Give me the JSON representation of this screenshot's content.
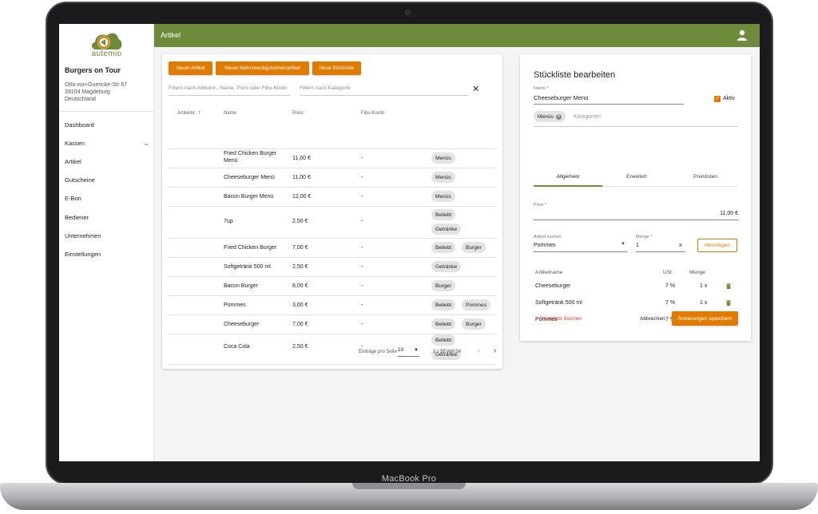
{
  "device": {
    "label": "MacBook Pro"
  },
  "sidebar": {
    "brand": "autemio",
    "company": "Burgers on Tour",
    "address": [
      "Otto-von-Guericke-Str 67",
      "39104 Magdeburg",
      "Deutschland"
    ],
    "items": [
      {
        "label": "Dashboard"
      },
      {
        "label": "Kassen",
        "expandable": true
      },
      {
        "label": "Artikel"
      },
      {
        "label": "Gutscheine"
      },
      {
        "label": "E-Bon"
      },
      {
        "label": "Bediener"
      },
      {
        "label": "Unternehmen"
      },
      {
        "label": "Einstellungen"
      }
    ]
  },
  "topbar": {
    "title": "Artikel",
    "user_icon": "user-icon"
  },
  "articles": {
    "buttons": {
      "new_article": "Neuer Artikel",
      "new_voucher_article": "Neuer Mehrzweckgutscheinartikel",
      "new_bom": "Neue Stückliste"
    },
    "filters": {
      "search_placeholder": "Filtern nach Artikelnr., Name, Preis oder Fibu-Konto",
      "category_placeholder": "Filtern nach Kategorie"
    },
    "columns": {
      "number": "Artikelnr.",
      "name": "Name",
      "price": "Preis",
      "account": "Fibu-Konto"
    },
    "rows": [
      {
        "number": "",
        "name": "Fried Chicken Burger Menü",
        "price": "11,00 €",
        "account": "-",
        "tags": [
          "Menüs"
        ]
      },
      {
        "number": "",
        "name": "Cheeseburger Menü",
        "price": "11,00 €",
        "account": "-",
        "tags": [
          "Menüs"
        ]
      },
      {
        "number": "",
        "name": "Bacon Burger Menü",
        "price": "12,00 €",
        "account": "-",
        "tags": [
          "Menüs"
        ]
      },
      {
        "number": "",
        "name": "7up",
        "price": "2,50 €",
        "account": "-",
        "tags": [
          "Beliebt",
          "Getränke"
        ]
      },
      {
        "number": "",
        "name": "Fried Chicken Burger",
        "price": "7,00 €",
        "account": "-",
        "tags": [
          "Beliebt",
          "Burger"
        ]
      },
      {
        "number": "",
        "name": "Softgetränk 500 ml",
        "price": "2,50 €",
        "account": "-",
        "tags": [
          "Getränke"
        ]
      },
      {
        "number": "",
        "name": "Bacon Burger",
        "price": "8,00 €",
        "account": "-",
        "tags": [
          "Burger"
        ]
      },
      {
        "number": "",
        "name": "Pommes",
        "price": "3,00 €",
        "account": "-",
        "tags": [
          "Beliebt",
          "Pommes"
        ]
      },
      {
        "number": "",
        "name": "Cheeseburger",
        "price": "7,00 €",
        "account": "-",
        "tags": [
          "Beliebt",
          "Burger"
        ]
      },
      {
        "number": "",
        "name": "Coca Cola",
        "price": "2,50 €",
        "account": "-",
        "tags": [
          "Beliebt",
          "Getränke"
        ]
      }
    ],
    "pagination": {
      "per_page_label": "Einträge pro Seite",
      "per_page": "10",
      "range": "1 - 10 von 14"
    }
  },
  "bom_editor": {
    "title": "Stückliste bearbeiten",
    "name_label": "Name *",
    "name_value": "Cheeseburger Menü",
    "active_label": "Aktiv",
    "active": true,
    "category_chip": "Menüs",
    "category_placeholder": "Kategorien",
    "tabs": [
      "Allgemein",
      "Erweitert",
      "Preislisten"
    ],
    "active_tab": "Allgemein",
    "price_label": "Preis *",
    "price_value": "11,00 €",
    "search_label": "Artikel suchen",
    "search_value": "Pommes",
    "qty_label": "Menge *",
    "qty_value": "1",
    "add_button": "Hinzufügen",
    "list_columns": {
      "name": "Artikelname",
      "tax": "USt.",
      "qty": "Menge"
    },
    "items": [
      {
        "name": "Cheeseburger",
        "tax": "7 %",
        "qty": "1 x"
      },
      {
        "name": "Softgetränk 500 ml",
        "tax": "7 %",
        "qty": "1 x"
      },
      {
        "name": "Pommes",
        "tax": "7 %",
        "qty": "1 x"
      }
    ],
    "delete_label": "Stückliste löschen",
    "cancel_label": "Abbrechen",
    "save_label": "Änderungen speichern"
  },
  "colors": {
    "primary_green": "#6d8b3a",
    "accent_orange": "#e07b00",
    "danger_red": "#d83a1e"
  }
}
